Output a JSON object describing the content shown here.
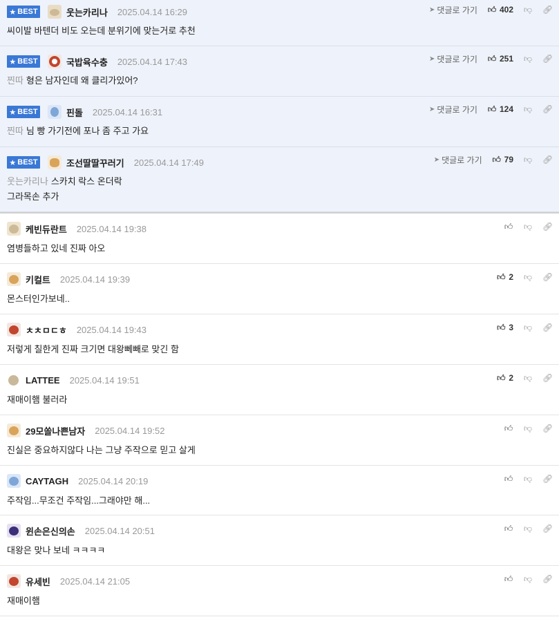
{
  "best_label": "BEST",
  "reply_go_label": "댓글로 가기",
  "best_comments": [
    {
      "nick": "웃는카리나",
      "date": "2025.04.14 16:29",
      "likes": "402",
      "mention": "",
      "lines": [
        "씨이발 바텐더 비도 오는데 분위기에 맞는거로 추천"
      ]
    },
    {
      "nick": "국밥육수충",
      "date": "2025.04.14 17:43",
      "likes": "251",
      "mention": "찐따",
      "lines": [
        "형은 남자인데 왜 클리가있어?"
      ]
    },
    {
      "nick": "핀돌",
      "date": "2025.04.14 16:31",
      "likes": "124",
      "mention": "찐따",
      "lines": [
        "님 빵 가기전에 포나 좀 주고 가요"
      ]
    },
    {
      "nick": "조선딸딸꾸러기",
      "date": "2025.04.14 17:49",
      "likes": "79",
      "mention": "웃는카리나",
      "lines": [
        "스카치 락스 온더락",
        "그라목손 추가"
      ]
    }
  ],
  "comments": [
    {
      "nick": "케빈듀란트",
      "date": "2025.04.14 19:38",
      "likes": "",
      "text": "염병들하고 있네 진짜 아오"
    },
    {
      "nick": "키컬트",
      "date": "2025.04.14 19:39",
      "likes": "2",
      "text": "몬스터인가보네.."
    },
    {
      "nick": "ㅊㅊㅁㄷㅎ",
      "date": "2025.04.14 19:43",
      "likes": "3",
      "text": "저렇게 칠한게 진짜 크기면 대왕뻬빼로 맞긴 함"
    },
    {
      "nick": "LATTEE",
      "date": "2025.04.14 19:51",
      "likes": "2",
      "text": "재매이햄 불러라"
    },
    {
      "nick": "29모쏠나쁜남자",
      "date": "2025.04.14 19:52",
      "likes": "",
      "text": "진실은 중요하지않다 나는 그냥 주작으로 믿고 살게"
    },
    {
      "nick": "CAYTAGH",
      "date": "2025.04.14 20:19",
      "likes": "",
      "text": "주작임...무조건 주작임...그래야만 해..."
    },
    {
      "nick": "윈손은신의손",
      "date": "2025.04.14 20:51",
      "likes": "",
      "text": "대왕은 맞나 보네 ㅋㅋㅋㅋ"
    },
    {
      "nick": "유세빈",
      "date": "2025.04.14 21:05",
      "likes": "",
      "text": "재매이햄"
    }
  ]
}
